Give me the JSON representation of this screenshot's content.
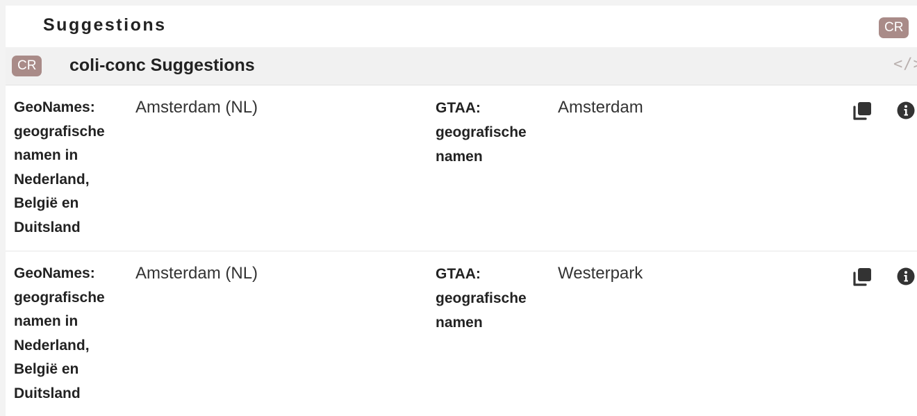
{
  "header": {
    "title": "Suggestions",
    "badge": "CR"
  },
  "section": {
    "badge": "CR",
    "title": "coli-conc Suggestions",
    "code_icon": "</>"
  },
  "mappings": [
    {
      "source_scheme": "GeoNames: geografische namen in Nederland, België en Duitsland",
      "source_concept": "Amsterdam (NL)",
      "target_scheme": "GTAA: geografische namen",
      "target_concept": "Amsterdam",
      "icons": [
        "copy-icon",
        "info-icon"
      ]
    },
    {
      "source_scheme": "GeoNames: geografische namen in Nederland, België en Duitsland",
      "source_concept": "Amsterdam (NL)",
      "target_scheme": "GTAA: geografische namen",
      "target_concept": "Westerpark",
      "icons": [
        "copy-icon",
        "info-icon"
      ]
    }
  ],
  "colors": {
    "badge": "#a98b88",
    "section_background": "#f1f1f1",
    "icon": "#333333"
  }
}
